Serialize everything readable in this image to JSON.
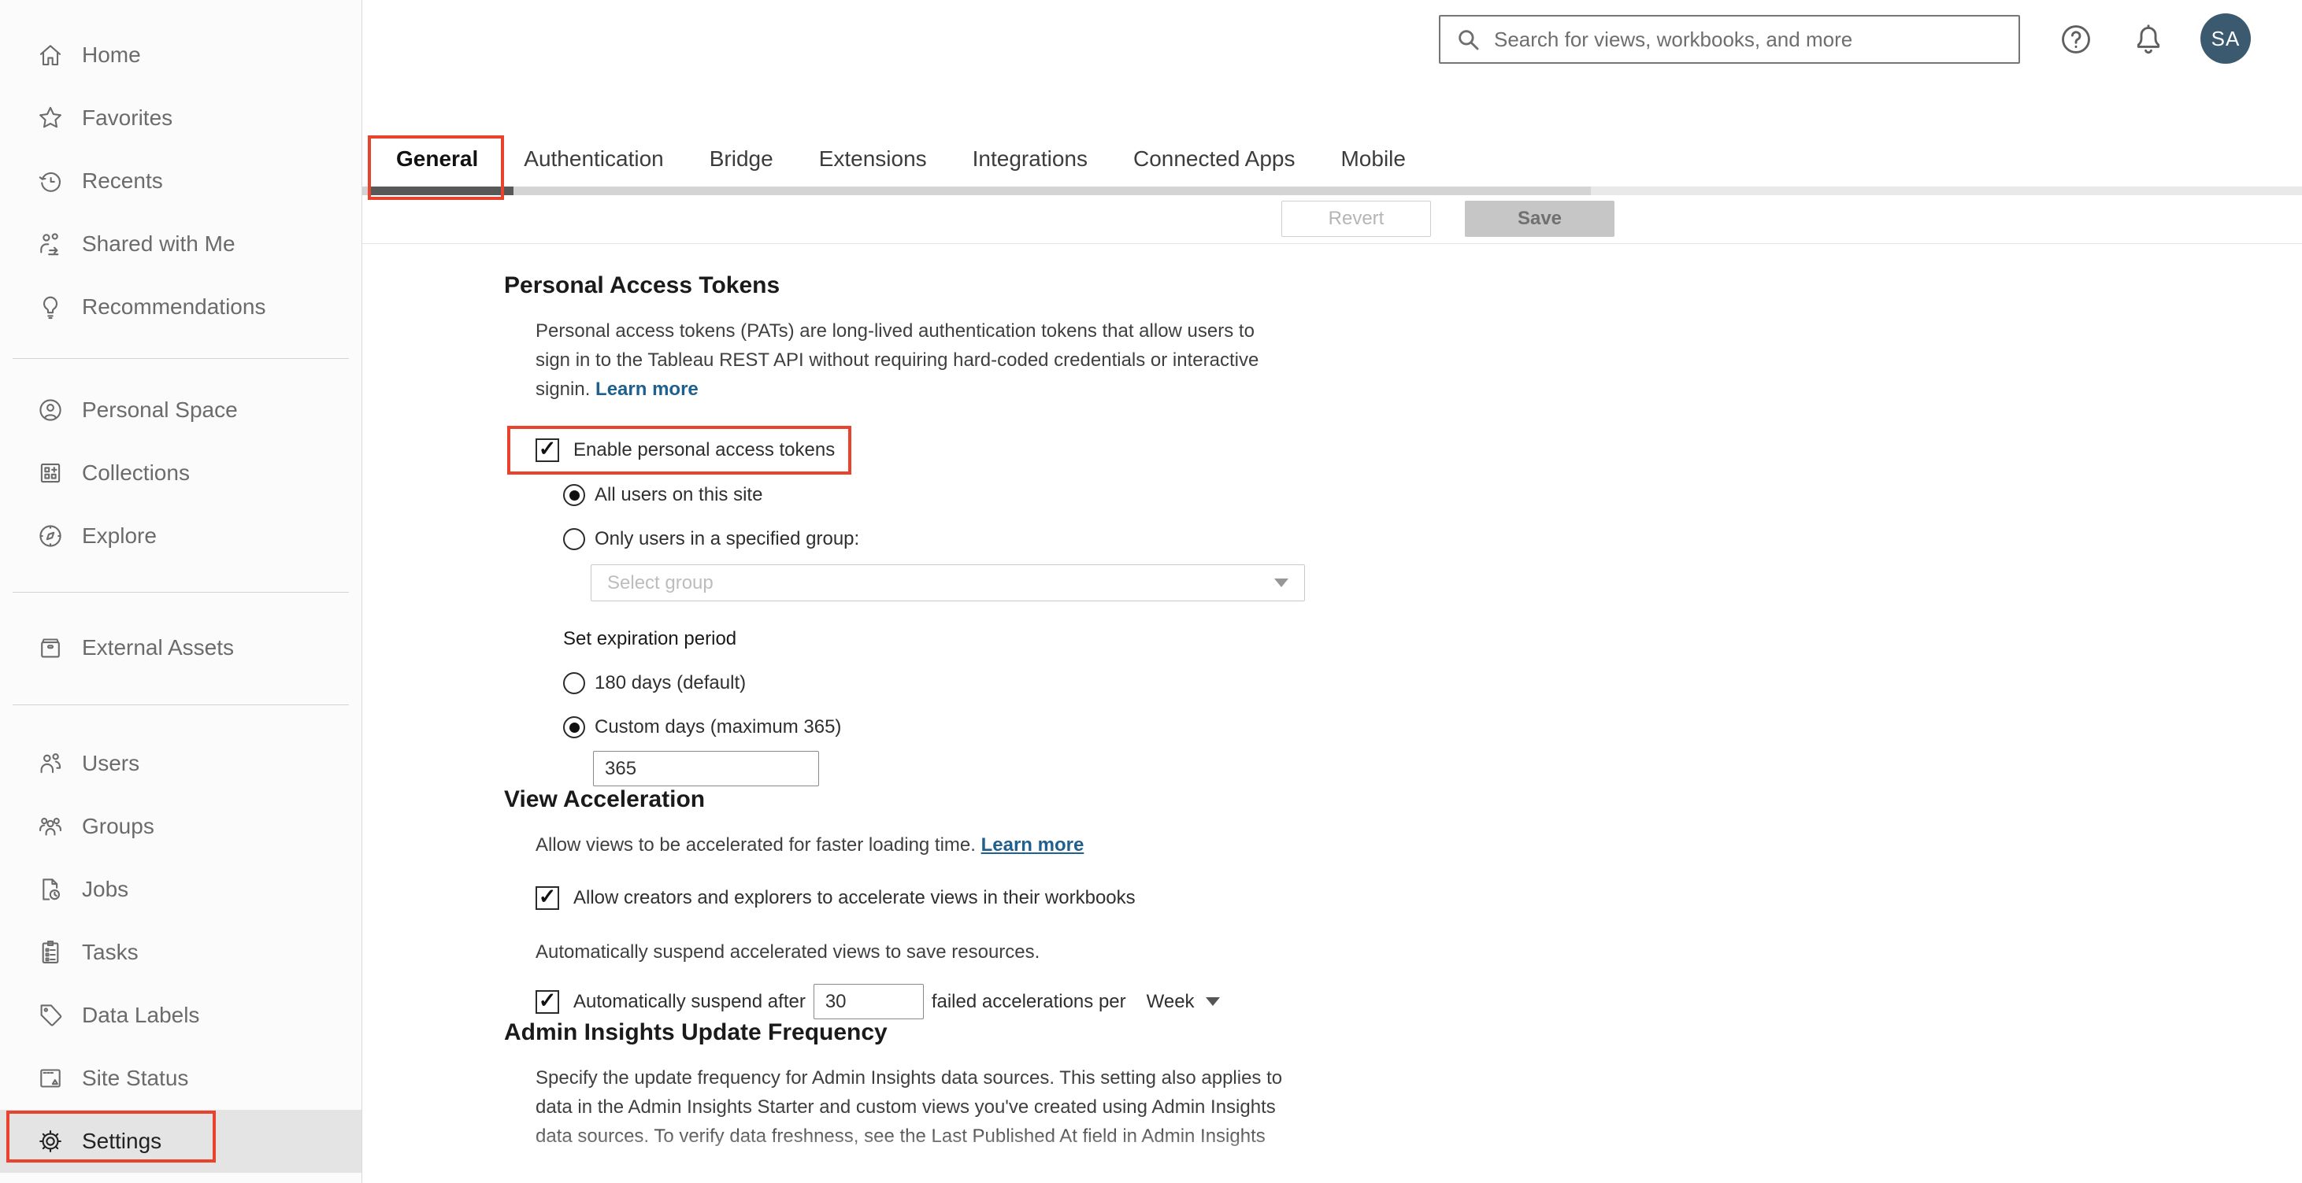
{
  "topbar": {
    "search_placeholder": "Search for views, workbooks, and more",
    "avatar_initials": "SA",
    "help_glyph": "?"
  },
  "sidebar": {
    "groups": [
      {
        "items": [
          {
            "label": "Home",
            "icon": "home-icon"
          },
          {
            "label": "Favorites",
            "icon": "star-icon"
          },
          {
            "label": "Recents",
            "icon": "recents-clock-icon"
          },
          {
            "label": "Shared with Me",
            "icon": "shared-with-me-icon"
          },
          {
            "label": "Recommendations",
            "icon": "lightbulb-icon"
          }
        ]
      },
      {
        "items": [
          {
            "label": "Personal Space",
            "icon": "person-circle-icon"
          },
          {
            "label": "Collections",
            "icon": "collections-icon"
          },
          {
            "label": "Explore",
            "icon": "compass-icon"
          }
        ]
      },
      {
        "items": [
          {
            "label": "External Assets",
            "icon": "archive-box-icon"
          }
        ]
      },
      {
        "items": [
          {
            "label": "Users",
            "icon": "users-icon"
          },
          {
            "label": "Groups",
            "icon": "groups-icon"
          },
          {
            "label": "Jobs",
            "icon": "document-clock-icon"
          },
          {
            "label": "Tasks",
            "icon": "clipboard-icon"
          },
          {
            "label": "Data Labels",
            "icon": "tag-icon"
          },
          {
            "label": "Site Status",
            "icon": "site-status-icon"
          },
          {
            "label": "Settings",
            "icon": "gear-icon",
            "active": true
          }
        ]
      }
    ]
  },
  "tabs": {
    "items": [
      {
        "label": "General",
        "active": true
      },
      {
        "label": "Authentication"
      },
      {
        "label": "Bridge"
      },
      {
        "label": "Extensions"
      },
      {
        "label": "Integrations"
      },
      {
        "label": "Connected Apps"
      },
      {
        "label": "Mobile"
      }
    ]
  },
  "actions": {
    "revert_label": "Revert",
    "save_label": "Save"
  },
  "sections": {
    "pat": {
      "title": "Personal Access Tokens",
      "description": "Personal access tokens (PATs) are long-lived authentication tokens that allow users to sign in to the Tableau REST API without requiring hard-coded credentials or interactive signin.",
      "learn_more": "Learn more",
      "enable_label": "Enable personal access tokens",
      "radio_all_users": "All users on this site",
      "radio_specified_group": "Only users in a specified group:",
      "group_select_placeholder": "Select group",
      "expiration_label": "Set expiration period",
      "radio_180_days": "180 days (default)",
      "radio_custom_days": "Custom days (maximum 365)",
      "custom_days_value": "365"
    },
    "view_acceleration": {
      "title": "View Acceleration",
      "description": "Allow views to be accelerated for faster loading time.",
      "learn_more": "Learn more",
      "allow_label": "Allow creators and explorers to accelerate views in their workbooks",
      "suspend_note": "Automatically suspend accelerated views to save resources.",
      "suspend_prefix": "Automatically suspend after",
      "suspend_value": "30",
      "suspend_suffix": "failed accelerations per",
      "period_value": "Week"
    },
    "admin_insights": {
      "title": "Admin Insights Update Frequency",
      "description": "Specify the update frequency for Admin Insights data sources. This setting also applies to data in the Admin Insights Starter and custom views you've created using Admin Insights data sources. To verify data freshness, see the Last Published At field in Admin Insights"
    }
  },
  "colors": {
    "annotation_red": "#e8432d",
    "link_blue": "#20608f",
    "avatar_bg": "#3b5a6f",
    "active_tab_underline": "#585858"
  }
}
